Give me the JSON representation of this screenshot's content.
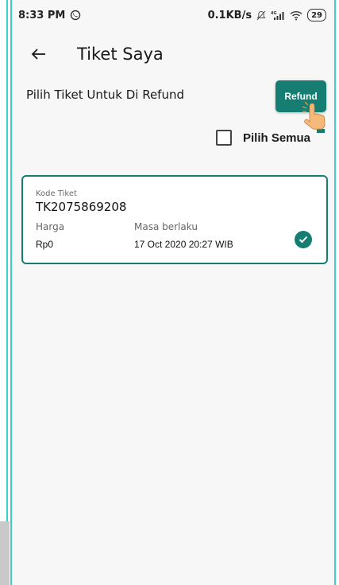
{
  "status_bar": {
    "time": "8:33 PM",
    "network_speed": "0.1KB/s",
    "battery": "29",
    "icons": [
      "whatsapp-icon",
      "mute-icon",
      "signal-4g-icon",
      "wifi-icon",
      "battery-icon"
    ]
  },
  "header": {
    "title": "Tiket Saya",
    "back_icon": "back-arrow-icon"
  },
  "refund_section": {
    "subtitle": "Pilih Tiket Untuk Di Refund",
    "refund_label": "Refund",
    "select_all_label": "Pilih Semua",
    "select_all_checked": false
  },
  "tickets": [
    {
      "code_label": "Kode Tiket",
      "code": "TK2075869208",
      "price_label": "Harga",
      "price": "Rp0",
      "validity_label": "Masa berlaku",
      "validity": "17 Oct 2020 20:27 WIB",
      "selected": true
    }
  ],
  "colors": {
    "primary": "#157d72",
    "frame_accent": "#3fd0c5",
    "background": "#f7f7f7"
  }
}
